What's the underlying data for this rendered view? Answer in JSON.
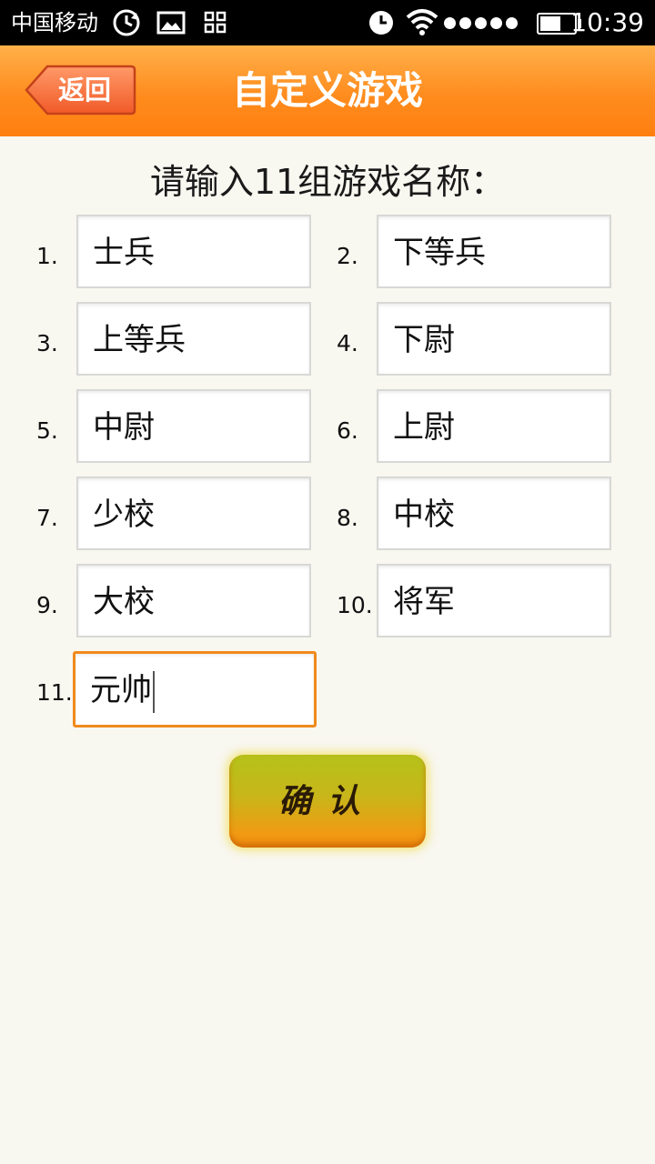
{
  "status_bar": {
    "carrier": "中国移动",
    "time": "10:39",
    "icons": [
      "sync-icon",
      "image-icon",
      "grid-icon",
      "clock-icon",
      "wifi-icon",
      "signal-dots-icon",
      "battery-icon"
    ]
  },
  "header": {
    "back_label": "返回",
    "title": "自定义游戏"
  },
  "prompt": "请输入11组游戏名称：",
  "fields": [
    {
      "number": "1.",
      "value": "士兵"
    },
    {
      "number": "2.",
      "value": "下等兵"
    },
    {
      "number": "3.",
      "value": "上等兵"
    },
    {
      "number": "4.",
      "value": "下尉"
    },
    {
      "number": "5.",
      "value": "中尉"
    },
    {
      "number": "6.",
      "value": "上尉"
    },
    {
      "number": "7.",
      "value": "少校"
    },
    {
      "number": "8.",
      "value": "中校"
    },
    {
      "number": "9.",
      "value": "大校"
    },
    {
      "number": "10.",
      "value": "将军"
    },
    {
      "number": "11.",
      "value": "元帅"
    }
  ],
  "confirm_label": "确认",
  "colors": {
    "header_orange": "#ff8c1e",
    "active_border": "#f08a1c",
    "background": "#f8f7f0"
  }
}
